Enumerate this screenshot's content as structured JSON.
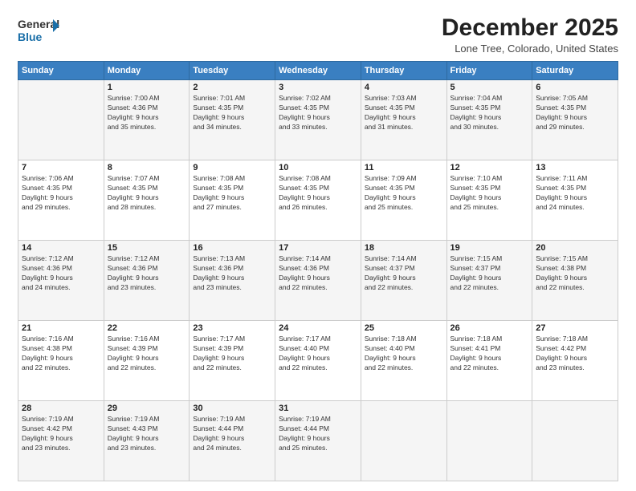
{
  "logo": {
    "line1": "General",
    "line2": "Blue"
  },
  "title": "December 2025",
  "subtitle": "Lone Tree, Colorado, United States",
  "days_of_week": [
    "Sunday",
    "Monday",
    "Tuesday",
    "Wednesday",
    "Thursday",
    "Friday",
    "Saturday"
  ],
  "weeks": [
    [
      {
        "day": "",
        "info": ""
      },
      {
        "day": "1",
        "info": "Sunrise: 7:00 AM\nSunset: 4:36 PM\nDaylight: 9 hours\nand 35 minutes."
      },
      {
        "day": "2",
        "info": "Sunrise: 7:01 AM\nSunset: 4:35 PM\nDaylight: 9 hours\nand 34 minutes."
      },
      {
        "day": "3",
        "info": "Sunrise: 7:02 AM\nSunset: 4:35 PM\nDaylight: 9 hours\nand 33 minutes."
      },
      {
        "day": "4",
        "info": "Sunrise: 7:03 AM\nSunset: 4:35 PM\nDaylight: 9 hours\nand 31 minutes."
      },
      {
        "day": "5",
        "info": "Sunrise: 7:04 AM\nSunset: 4:35 PM\nDaylight: 9 hours\nand 30 minutes."
      },
      {
        "day": "6",
        "info": "Sunrise: 7:05 AM\nSunset: 4:35 PM\nDaylight: 9 hours\nand 29 minutes."
      }
    ],
    [
      {
        "day": "7",
        "info": "Sunrise: 7:06 AM\nSunset: 4:35 PM\nDaylight: 9 hours\nand 29 minutes."
      },
      {
        "day": "8",
        "info": "Sunrise: 7:07 AM\nSunset: 4:35 PM\nDaylight: 9 hours\nand 28 minutes."
      },
      {
        "day": "9",
        "info": "Sunrise: 7:08 AM\nSunset: 4:35 PM\nDaylight: 9 hours\nand 27 minutes."
      },
      {
        "day": "10",
        "info": "Sunrise: 7:08 AM\nSunset: 4:35 PM\nDaylight: 9 hours\nand 26 minutes."
      },
      {
        "day": "11",
        "info": "Sunrise: 7:09 AM\nSunset: 4:35 PM\nDaylight: 9 hours\nand 25 minutes."
      },
      {
        "day": "12",
        "info": "Sunrise: 7:10 AM\nSunset: 4:35 PM\nDaylight: 9 hours\nand 25 minutes."
      },
      {
        "day": "13",
        "info": "Sunrise: 7:11 AM\nSunset: 4:35 PM\nDaylight: 9 hours\nand 24 minutes."
      }
    ],
    [
      {
        "day": "14",
        "info": "Sunrise: 7:12 AM\nSunset: 4:36 PM\nDaylight: 9 hours\nand 24 minutes."
      },
      {
        "day": "15",
        "info": "Sunrise: 7:12 AM\nSunset: 4:36 PM\nDaylight: 9 hours\nand 23 minutes."
      },
      {
        "day": "16",
        "info": "Sunrise: 7:13 AM\nSunset: 4:36 PM\nDaylight: 9 hours\nand 23 minutes."
      },
      {
        "day": "17",
        "info": "Sunrise: 7:14 AM\nSunset: 4:36 PM\nDaylight: 9 hours\nand 22 minutes."
      },
      {
        "day": "18",
        "info": "Sunrise: 7:14 AM\nSunset: 4:37 PM\nDaylight: 9 hours\nand 22 minutes."
      },
      {
        "day": "19",
        "info": "Sunrise: 7:15 AM\nSunset: 4:37 PM\nDaylight: 9 hours\nand 22 minutes."
      },
      {
        "day": "20",
        "info": "Sunrise: 7:15 AM\nSunset: 4:38 PM\nDaylight: 9 hours\nand 22 minutes."
      }
    ],
    [
      {
        "day": "21",
        "info": "Sunrise: 7:16 AM\nSunset: 4:38 PM\nDaylight: 9 hours\nand 22 minutes."
      },
      {
        "day": "22",
        "info": "Sunrise: 7:16 AM\nSunset: 4:39 PM\nDaylight: 9 hours\nand 22 minutes."
      },
      {
        "day": "23",
        "info": "Sunrise: 7:17 AM\nSunset: 4:39 PM\nDaylight: 9 hours\nand 22 minutes."
      },
      {
        "day": "24",
        "info": "Sunrise: 7:17 AM\nSunset: 4:40 PM\nDaylight: 9 hours\nand 22 minutes."
      },
      {
        "day": "25",
        "info": "Sunrise: 7:18 AM\nSunset: 4:40 PM\nDaylight: 9 hours\nand 22 minutes."
      },
      {
        "day": "26",
        "info": "Sunrise: 7:18 AM\nSunset: 4:41 PM\nDaylight: 9 hours\nand 22 minutes."
      },
      {
        "day": "27",
        "info": "Sunrise: 7:18 AM\nSunset: 4:42 PM\nDaylight: 9 hours\nand 23 minutes."
      }
    ],
    [
      {
        "day": "28",
        "info": "Sunrise: 7:19 AM\nSunset: 4:42 PM\nDaylight: 9 hours\nand 23 minutes."
      },
      {
        "day": "29",
        "info": "Sunrise: 7:19 AM\nSunset: 4:43 PM\nDaylight: 9 hours\nand 23 minutes."
      },
      {
        "day": "30",
        "info": "Sunrise: 7:19 AM\nSunset: 4:44 PM\nDaylight: 9 hours\nand 24 minutes."
      },
      {
        "day": "31",
        "info": "Sunrise: 7:19 AM\nSunset: 4:44 PM\nDaylight: 9 hours\nand 25 minutes."
      },
      {
        "day": "",
        "info": ""
      },
      {
        "day": "",
        "info": ""
      },
      {
        "day": "",
        "info": ""
      }
    ]
  ]
}
